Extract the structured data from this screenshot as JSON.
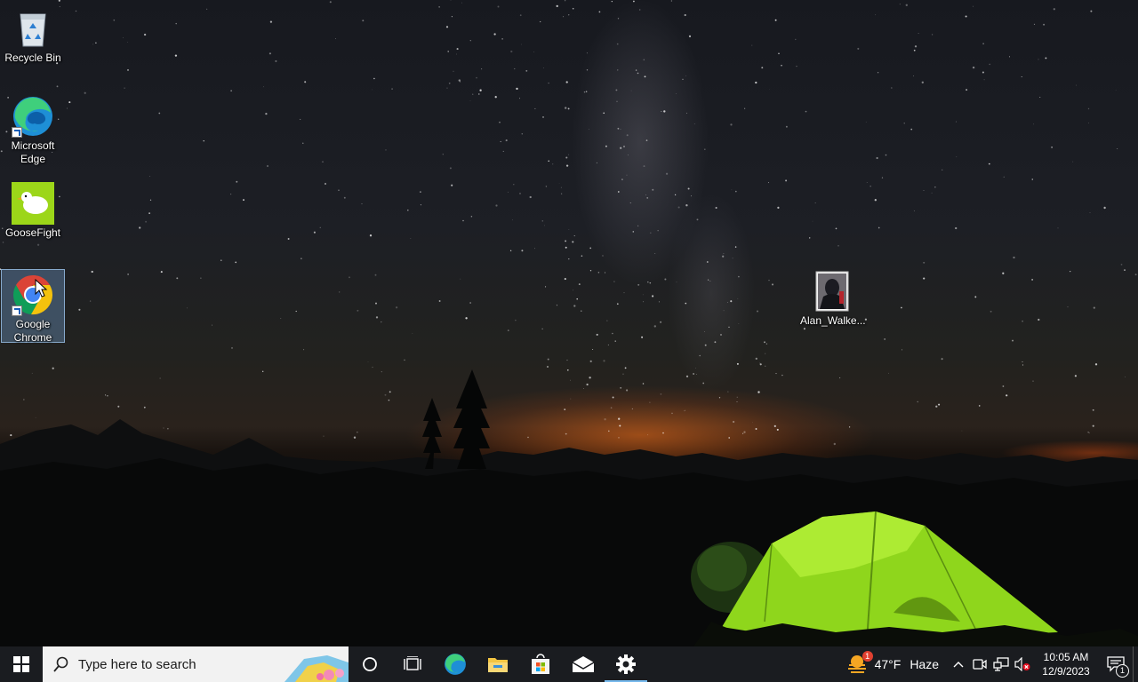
{
  "desktop": {
    "icons": [
      {
        "label": "Recycle Bin",
        "icon": "recycle-bin-icon"
      },
      {
        "label": "Microsoft Edge",
        "icon": "edge-icon"
      },
      {
        "label": "GooseFight",
        "icon": "goose-icon"
      },
      {
        "label": "Google Chrome",
        "icon": "chrome-icon",
        "selected": true
      },
      {
        "label": "Alan_Walke...",
        "icon": "image-file-icon"
      }
    ]
  },
  "taskbar": {
    "search_placeholder": "Type here to search",
    "pinned": [
      "cortana-icon",
      "task-view-icon",
      "edge-icon",
      "file-explorer-icon",
      "microsoft-store-icon",
      "mail-icon",
      "settings-icon"
    ],
    "active_app": "settings-icon",
    "weather": {
      "temp": "47°F",
      "condition": "Haze",
      "alert_badge": "1"
    },
    "clock": {
      "time": "10:05 AM",
      "date": "12/9/2023"
    },
    "notification_count": "1"
  },
  "colors": {
    "taskbar_bg": "#1a1c20",
    "accent": "#76b9ed",
    "tent": "#9be01e"
  }
}
